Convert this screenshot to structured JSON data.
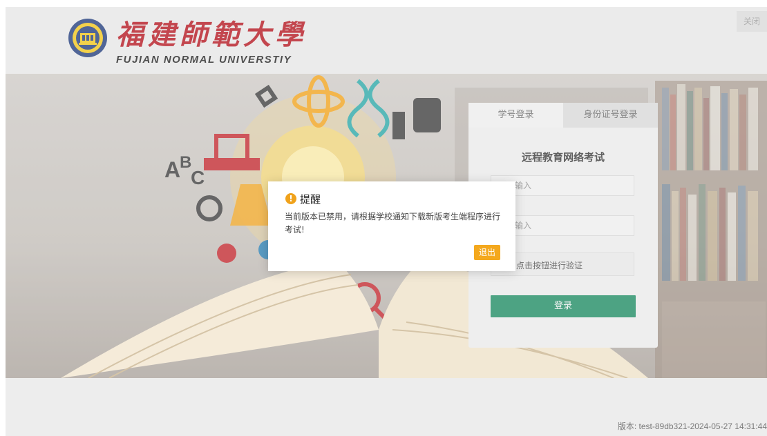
{
  "header": {
    "logo_cn": "福建師範大學",
    "logo_en": "FUJIAN NORMAL UNIVERSTIY",
    "close_label": "关闭"
  },
  "login": {
    "tabs": [
      "学号登录",
      "身份证号登录"
    ],
    "title": "远程教育网络考试",
    "field1_placeholder": "输入",
    "field2_placeholder": "输入",
    "verify_label": "点击按钮进行验证",
    "login_label": "登录"
  },
  "dialog": {
    "icon": "!",
    "title": "提醒",
    "message": "当前版本已禁用，请根据学校通知下载新版考生端程序进行考试!",
    "button_label": "退出"
  },
  "footer": {
    "version": "版本: test-89db321-2024-05-27 14:31:44"
  },
  "colors": {
    "primary_green": "#1c8a60",
    "warning_orange": "#f4a81d",
    "logo_red": "#b3121d"
  }
}
